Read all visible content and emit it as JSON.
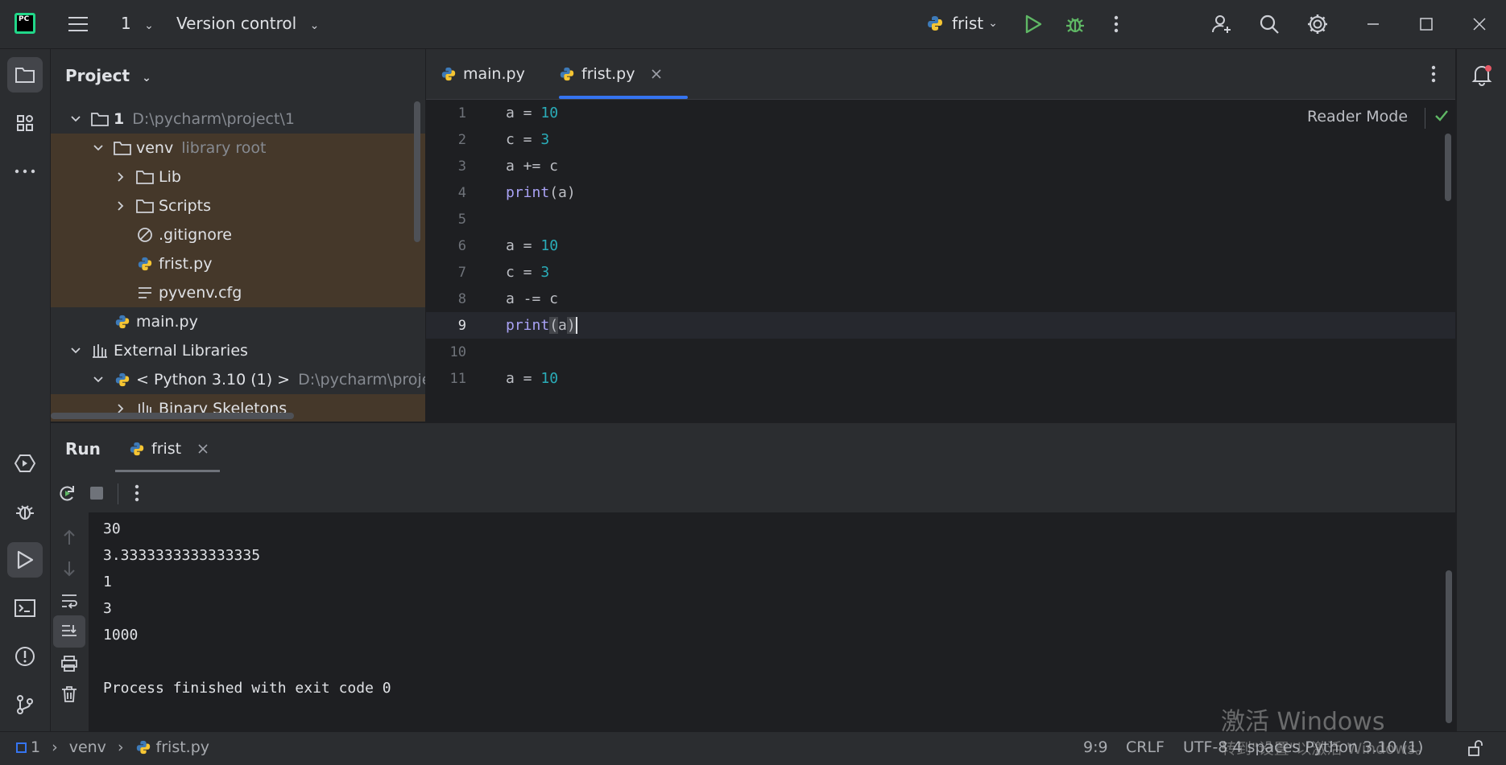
{
  "titlebar": {
    "project_name": "1",
    "vcs": "Version control",
    "run_config": "frist"
  },
  "project_panel": {
    "title": "Project",
    "tree": [
      {
        "label": "1",
        "path": "D:\\pycharm\\project\\1"
      },
      {
        "label": "venv",
        "hint": "library root"
      },
      {
        "label": "Lib"
      },
      {
        "label": "Scripts"
      },
      {
        "label": ".gitignore"
      },
      {
        "label": "frist.py"
      },
      {
        "label": "pyvenv.cfg"
      },
      {
        "label": "main.py"
      },
      {
        "label": "External Libraries"
      },
      {
        "label": "< Python 3.10 (1) >",
        "path": "D:\\pycharm\\project"
      },
      {
        "label": "Binary Skeletons"
      }
    ]
  },
  "editor": {
    "tabs": [
      {
        "label": "main.py"
      },
      {
        "label": "frist.py"
      }
    ],
    "reader_mode": "Reader Mode",
    "line_numbers": [
      "1",
      "2",
      "3",
      "4",
      "5",
      "6",
      "7",
      "8",
      "9",
      "10",
      "11"
    ],
    "current_line": "9"
  },
  "run_panel": {
    "title": "Run",
    "tab": "frist",
    "output": [
      "30",
      "3.3333333333333335",
      "1",
      "3",
      "1000",
      "",
      "Process finished with exit code 0"
    ]
  },
  "statusbar": {
    "crumb_project": "1",
    "crumb_folder": "venv",
    "crumb_file": "frist.py",
    "position": "9:9",
    "line_separator": "CRLF",
    "encoding_interp": "UTF-8   4 spaces   Python 3.10 (1)"
  },
  "watermark": {
    "line1": "激活 Windows",
    "line2": "转到\"设置\"以激活 Windows。"
  },
  "colors": {
    "accent": "#3574f0",
    "highlight_row": "#45382a",
    "run_green": "#5fb865",
    "number": "#2aacb8",
    "keyword": "#a9a2f5"
  }
}
